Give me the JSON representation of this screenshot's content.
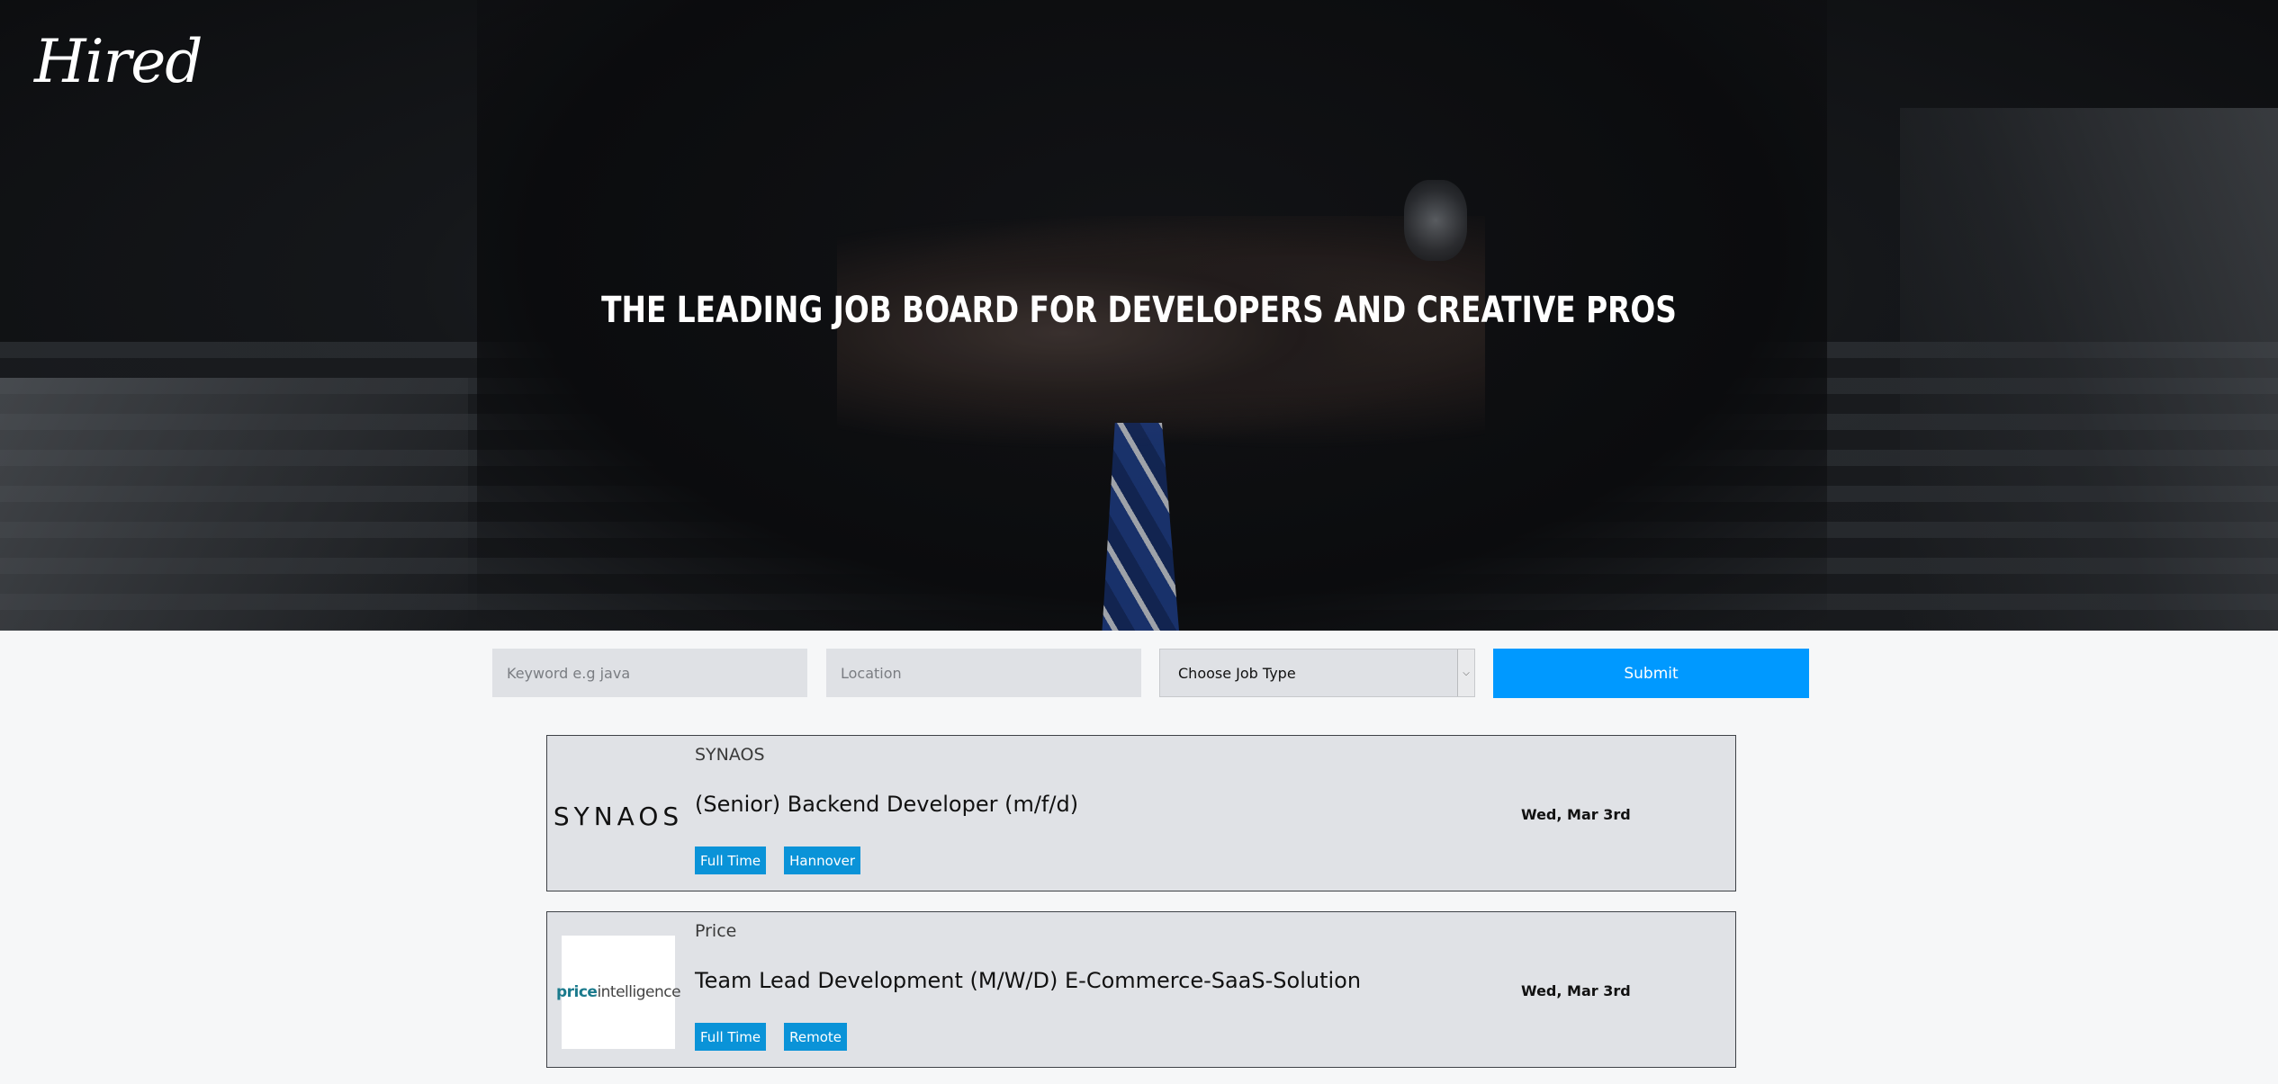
{
  "brand": {
    "logo_text": "Hired"
  },
  "hero": {
    "headline": "THE LEADING JOB BOARD FOR DEVELOPERS AND CREATIVE PROS"
  },
  "search": {
    "keyword_placeholder": "Keyword e.g java",
    "location_placeholder": "Location",
    "job_type_selected": "Choose Job Type",
    "submit_label": "Submit"
  },
  "colors": {
    "accent": "#0099ff",
    "tag": "#0a93d8",
    "card_bg": "#e0e2e6"
  },
  "jobs": [
    {
      "company": "SYNAOS",
      "logo_text": "SYNAOS",
      "title": "(Senior) Backend Developer (m/f/d)",
      "tags": [
        "Full Time",
        "Hannover"
      ],
      "date": "Wed, Mar 3rd"
    },
    {
      "company": "Price",
      "logo_text_a": "price",
      "logo_text_b": "intelligence",
      "title": "Team Lead Development (M/W/D) E-Commerce-SaaS-Solution",
      "tags": [
        "Full Time",
        "Remote"
      ],
      "date": "Wed, Mar 3rd"
    }
  ]
}
